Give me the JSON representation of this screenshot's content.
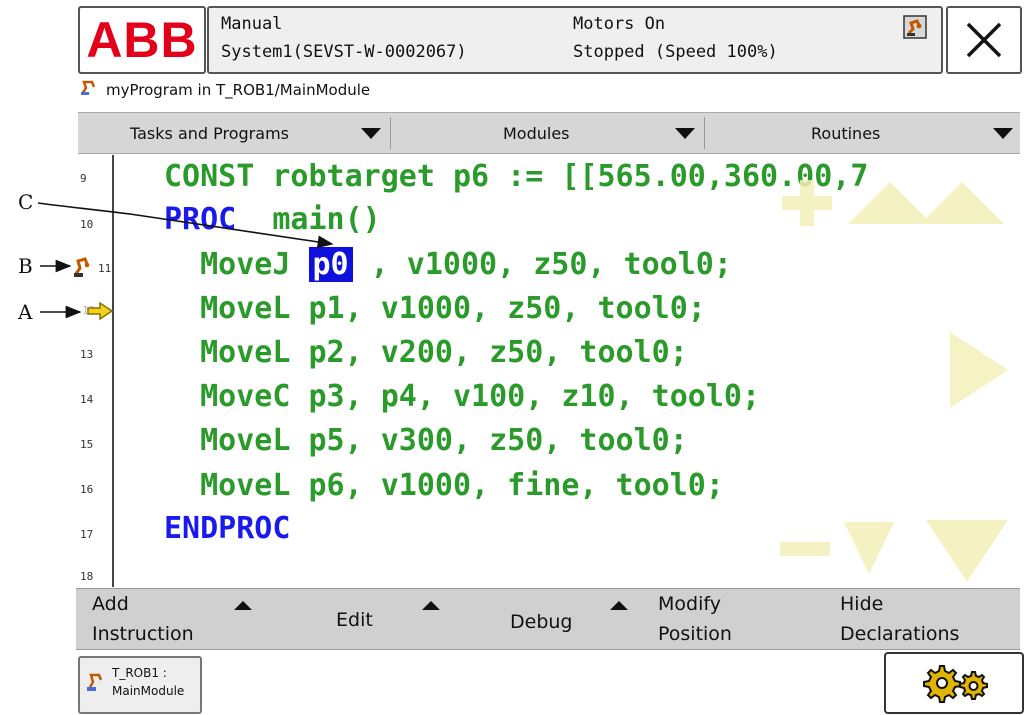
{
  "header": {
    "logo": "ABB",
    "mode": "Manual",
    "system": "System1(SEVST-W-0002067)",
    "motors": "Motors On",
    "state": "Stopped (Speed 100%)",
    "close_icon": "close-icon"
  },
  "breadcrumb": "myProgram in T_ROB1/MainModule",
  "dropdowns": [
    "Tasks and Programs",
    "Modules",
    "Routines"
  ],
  "code_lines": [
    {
      "num": "9",
      "text": "CONST robtarget p6 := [[565.00,360.00,7"
    },
    {
      "num": "10",
      "kw": "PROC",
      "rest": "  main()"
    },
    {
      "num": "11",
      "pre": "  MoveJ ",
      "sel": "p0",
      "post": " , v1000, z50, tool0;"
    },
    {
      "num": "12",
      "text": "  MoveL p1, v1000, z50, tool0;"
    },
    {
      "num": "13",
      "text": "  MoveL p2, v200, z50, tool0;"
    },
    {
      "num": "14",
      "text": "  MoveC p3, p4, v100, z10, tool0;"
    },
    {
      "num": "15",
      "text": "  MoveL p5, v300, z50, tool0;"
    },
    {
      "num": "16",
      "text": "  MoveL p6, v1000, fine, tool0;"
    },
    {
      "num": "17",
      "kw": "ENDPROC",
      "rest": ""
    },
    {
      "num": "18",
      "text": ""
    }
  ],
  "callouts": {
    "a": "A",
    "b": "B",
    "c": "C"
  },
  "menu": {
    "add_instruction": [
      "Add",
      "Instruction"
    ],
    "edit": "Edit",
    "debug": "Debug",
    "modify_position": [
      "Modify",
      "Position"
    ],
    "hide_declarations": [
      "Hide",
      "Declarations"
    ]
  },
  "taskbar": {
    "task": [
      "T_ROB1 :",
      "MainModule"
    ],
    "settings_icon": "gears-icon"
  },
  "colors": {
    "abb_red": "#e2001a",
    "code_green": "#2a9a2a",
    "keyword_blue": "#1a1aee",
    "selection": "#1010dd",
    "nav_arrows": "#f3f0b8"
  }
}
